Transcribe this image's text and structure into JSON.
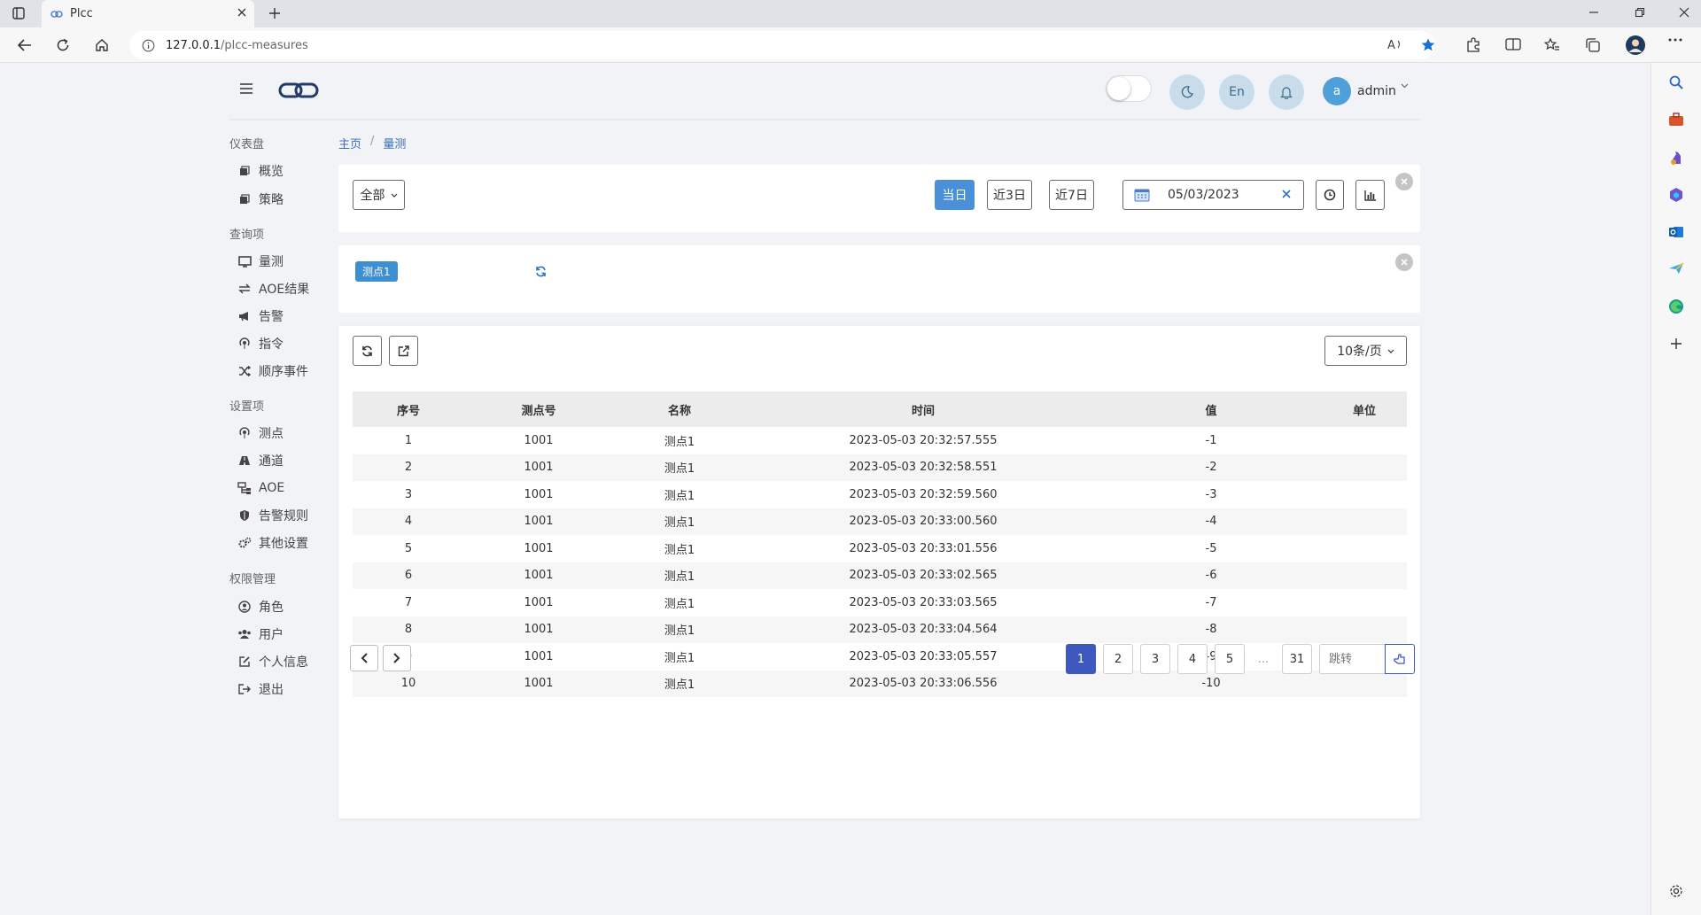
{
  "browser": {
    "tab_title": "Plcc",
    "url_host": "127.0.0.1",
    "url_path": "/plcc-measures"
  },
  "header": {
    "lang_label": "En",
    "user_initial": "a",
    "user_name": "admin"
  },
  "sidebar": {
    "sections": [
      {
        "title": "仪表盘",
        "items": [
          {
            "label": "概览",
            "icon": "cube-icon"
          },
          {
            "label": "策略",
            "icon": "cube-icon"
          }
        ]
      },
      {
        "title": "查询项",
        "items": [
          {
            "label": "量测",
            "icon": "monitor-icon"
          },
          {
            "label": "AOE结果",
            "icon": "exchange-icon"
          },
          {
            "label": "告警",
            "icon": "bullhorn-icon"
          },
          {
            "label": "指令",
            "icon": "podcast-icon"
          },
          {
            "label": "顺序事件",
            "icon": "random-icon"
          }
        ]
      },
      {
        "title": "设置项",
        "items": [
          {
            "label": "测点",
            "icon": "podcast-icon"
          },
          {
            "label": "通道",
            "icon": "road-icon"
          },
          {
            "label": "AOE",
            "icon": "sitemap-icon"
          },
          {
            "label": "告警规则",
            "icon": "shield-icon"
          },
          {
            "label": "其他设置",
            "icon": "cogs-icon"
          }
        ]
      },
      {
        "title": "权限管理",
        "items": [
          {
            "label": "角色",
            "icon": "user-circle-icon"
          },
          {
            "label": "用户",
            "icon": "users-icon"
          },
          {
            "label": "个人信息",
            "icon": "edit-icon"
          },
          {
            "label": "退出",
            "icon": "sign-out-icon"
          }
        ]
      }
    ]
  },
  "breadcrumb": {
    "home": "主页",
    "separator": "/",
    "current": "量测"
  },
  "filter": {
    "scope_select": "全部",
    "range_buttons": [
      "当日",
      "近3日",
      "近7日"
    ],
    "active_range": "当日",
    "date_value": "05/03/2023"
  },
  "selection": {
    "tag": "测点1"
  },
  "table": {
    "page_size": "10条/页",
    "columns": [
      "序号",
      "测点号",
      "名称",
      "时间",
      "值",
      "单位"
    ],
    "rows": [
      [
        "1",
        "1001",
        "测点1",
        "2023-05-03 20:32:57.555",
        "-1",
        ""
      ],
      [
        "2",
        "1001",
        "测点1",
        "2023-05-03 20:32:58.551",
        "-2",
        ""
      ],
      [
        "3",
        "1001",
        "测点1",
        "2023-05-03 20:32:59.560",
        "-3",
        ""
      ],
      [
        "4",
        "1001",
        "测点1",
        "2023-05-03 20:33:00.560",
        "-4",
        ""
      ],
      [
        "5",
        "1001",
        "测点1",
        "2023-05-03 20:33:01.556",
        "-5",
        ""
      ],
      [
        "6",
        "1001",
        "测点1",
        "2023-05-03 20:33:02.565",
        "-6",
        ""
      ],
      [
        "7",
        "1001",
        "测点1",
        "2023-05-03 20:33:03.565",
        "-7",
        ""
      ],
      [
        "8",
        "1001",
        "测点1",
        "2023-05-03 20:33:04.564",
        "-8",
        ""
      ],
      [
        "9",
        "1001",
        "测点1",
        "2023-05-03 20:33:05.557",
        "-9",
        ""
      ],
      [
        "10",
        "1001",
        "测点1",
        "2023-05-03 20:33:06.556",
        "-10",
        ""
      ]
    ]
  },
  "pagination": {
    "pages": [
      "1",
      "2",
      "3",
      "4",
      "5"
    ],
    "ellipsis": "...",
    "last": "31",
    "current": "1",
    "jump_placeholder": "跳转"
  }
}
